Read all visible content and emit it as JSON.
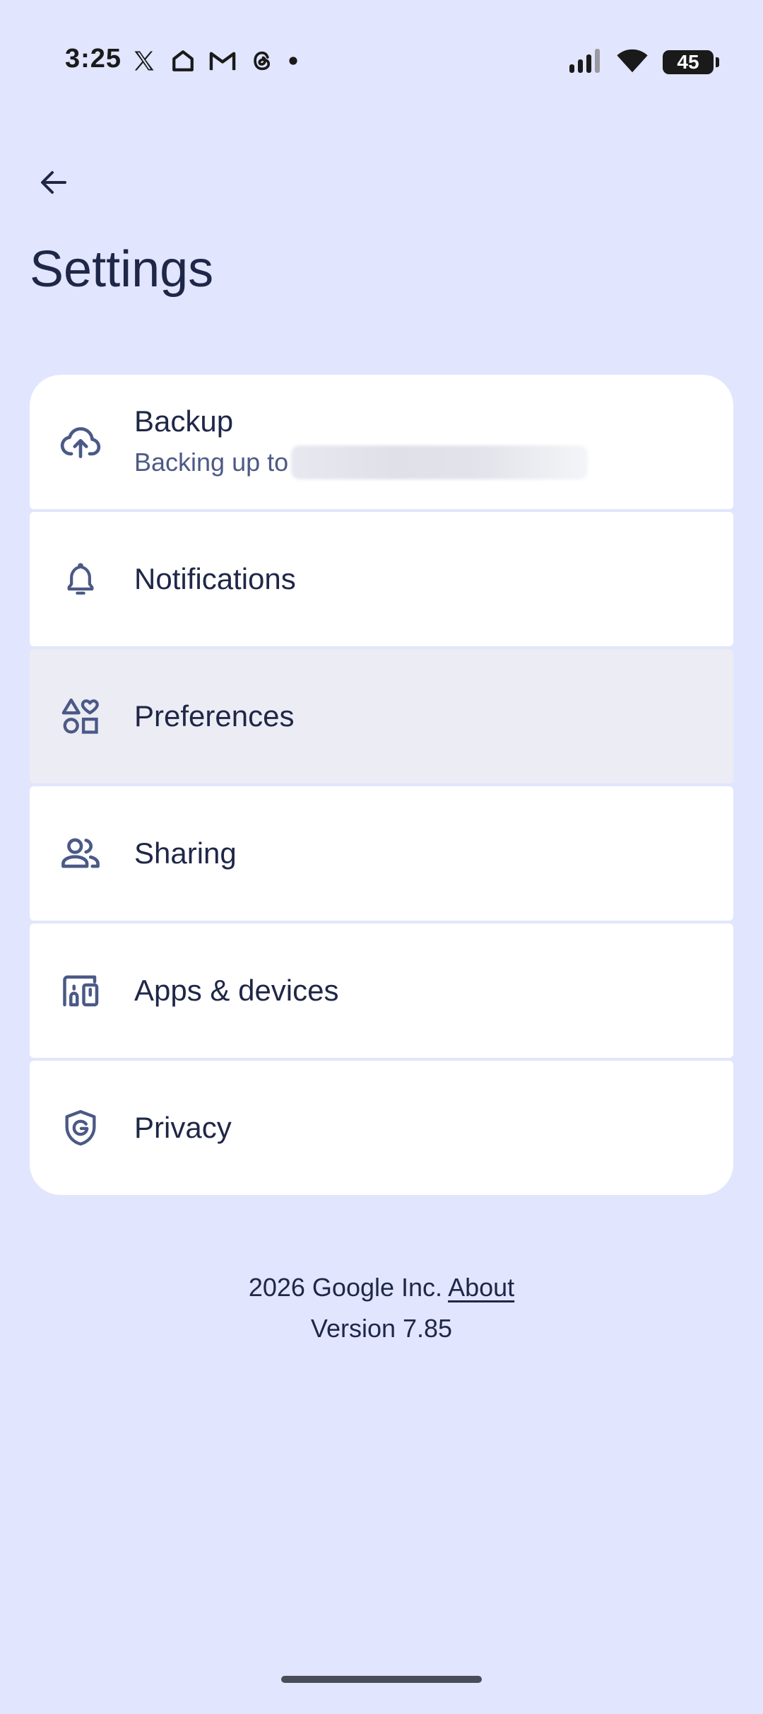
{
  "status_bar": {
    "time": "3:25",
    "battery_level": "45",
    "notification_icons": [
      "x-app-icon",
      "home-icon",
      "gmail-icon",
      "threads-icon",
      "dot-icon"
    ],
    "system_icons": [
      "signal-icon",
      "wifi-icon",
      "battery-icon"
    ]
  },
  "header": {
    "back_icon": "arrow-back-icon",
    "title": "Settings"
  },
  "settings": {
    "items": [
      {
        "label": "Backup",
        "subtitle": "Backing up to",
        "icon": "cloud-upload-icon"
      },
      {
        "label": "Notifications",
        "icon": "bell-icon"
      },
      {
        "label": "Preferences",
        "icon": "shapes-icon"
      },
      {
        "label": "Sharing",
        "icon": "people-icon"
      },
      {
        "label": "Apps & devices",
        "icon": "devices-icon"
      },
      {
        "label": "Privacy",
        "icon": "shield-g-icon"
      }
    ]
  },
  "footer": {
    "copyright": "2026 Google Inc.",
    "about_link": "About",
    "version": "Version 7.85"
  },
  "colors": {
    "background": "#e1e5fd",
    "card": "#ffffff",
    "pressed_card": "#ececf4",
    "text_primary": "#1f2748",
    "text_secondary": "#4d5a85",
    "icon": "#4b5986"
  }
}
